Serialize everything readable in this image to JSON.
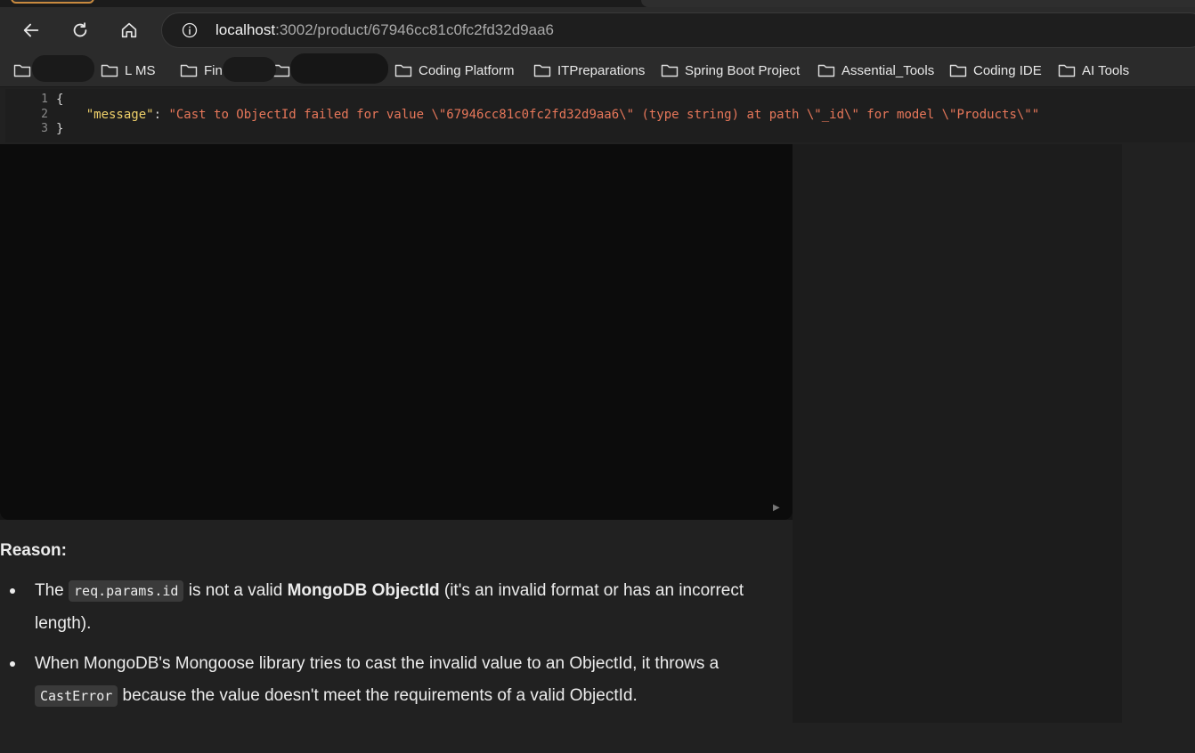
{
  "browser": {
    "url_host": "localhost",
    "url_path": ":3002/product/67946cc81c0fc2fd32d9aa6",
    "back_icon": "arrow-left",
    "reload_icon": "reload",
    "home_icon": "home",
    "site_info_icon": "info-circle"
  },
  "bookmarks": [
    {
      "label": ""
    },
    {
      "label": "L  MS"
    },
    {
      "label": "Finc"
    },
    {
      "label": ""
    },
    {
      "label": "Coding Platform"
    },
    {
      "label": "ITPreparations"
    },
    {
      "label": "Spring Boot Project"
    },
    {
      "label": "Assential_Tools"
    },
    {
      "label": "Coding IDE"
    },
    {
      "label": "AI Tools"
    }
  ],
  "json_viewer": {
    "line_numbers": [
      "1",
      "2",
      "3"
    ],
    "open_brace": "{",
    "key": "\"message\"",
    "colon": ": ",
    "value": "\"Cast to ObjectId failed for value \\\"67946cc81c0fc2fd32d9aa6\\\" (type string) at path \\\"_id\\\" for model \\\"Products\\\"\"",
    "close_brace": "}"
  },
  "answer": {
    "heading": "Reason:",
    "points": [
      {
        "pre": "The ",
        "code": "req.params.id",
        "mid": " is not a valid ",
        "bold": "MongoDB ObjectId",
        "post": " (it's an invalid format or has an incorrect length)."
      },
      {
        "pre": "When MongoDB's Mongoose library tries to cast the invalid value to an ObjectId, it throws a ",
        "code": "CastError",
        "post": " because the value doesn't meet the requirements of a valid ObjectId."
      }
    ]
  }
}
